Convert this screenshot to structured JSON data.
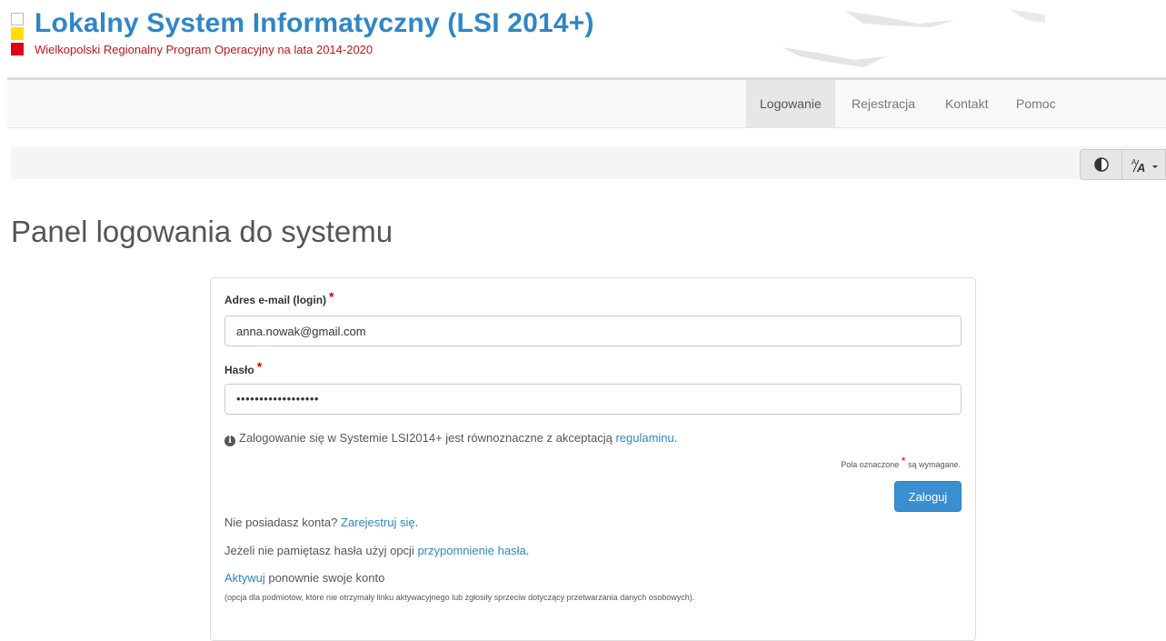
{
  "header": {
    "title": "Lokalny System Informatyczny (LSI 2014+)",
    "subtitle": "Wielkopolski Regionalny Program Operacyjny na lata 2014-2020"
  },
  "nav": {
    "items": [
      {
        "label": "Logowanie",
        "active": true
      },
      {
        "label": "Rejestracja",
        "active": false
      },
      {
        "label": "Kontakt",
        "active": false
      },
      {
        "label": "Pomoc",
        "active": false
      }
    ]
  },
  "toolbar": {
    "contrast_icon": "contrast-icon",
    "font_size_icon": "font-size-icon",
    "font_size_label": "A/A"
  },
  "page": {
    "title": "Panel logowania do systemu"
  },
  "form": {
    "email_label": "Adres e-mail (login)",
    "email_value": "anna.nowak@gmail.com",
    "password_label": "Hasło",
    "password_value": "••••••••••••••••••",
    "required_mark": "*",
    "info_text": "Zalogowanie się w Systemie LSI2014+ jest równoznaczne z akceptacją",
    "info_link": "regulaminu",
    "required_note_before": "Pola oznaczone",
    "required_note_after": "są wymagane.",
    "login_button": "Zaloguj",
    "no_account_text": "Nie posiadasz konta?",
    "register_link": "Zarejestruj się",
    "forgot_text": "Jeżeli nie pamiętasz hasła użyj opcji",
    "forgot_link": "przypomnienie hasła",
    "activate_link": "Aktywuj",
    "activate_text": "ponownie swoje konto",
    "activate_note": "(opcja dla podmiotów, które nie otrzymały linku aktywacyjnego lub zgłosiły sprzeciw dotyczący przetwarzania danych osobowych)."
  },
  "colors": {
    "brand_blue": "#2f86c6",
    "subtitle_red": "#c0161b",
    "button_blue": "#3a8fd0"
  }
}
